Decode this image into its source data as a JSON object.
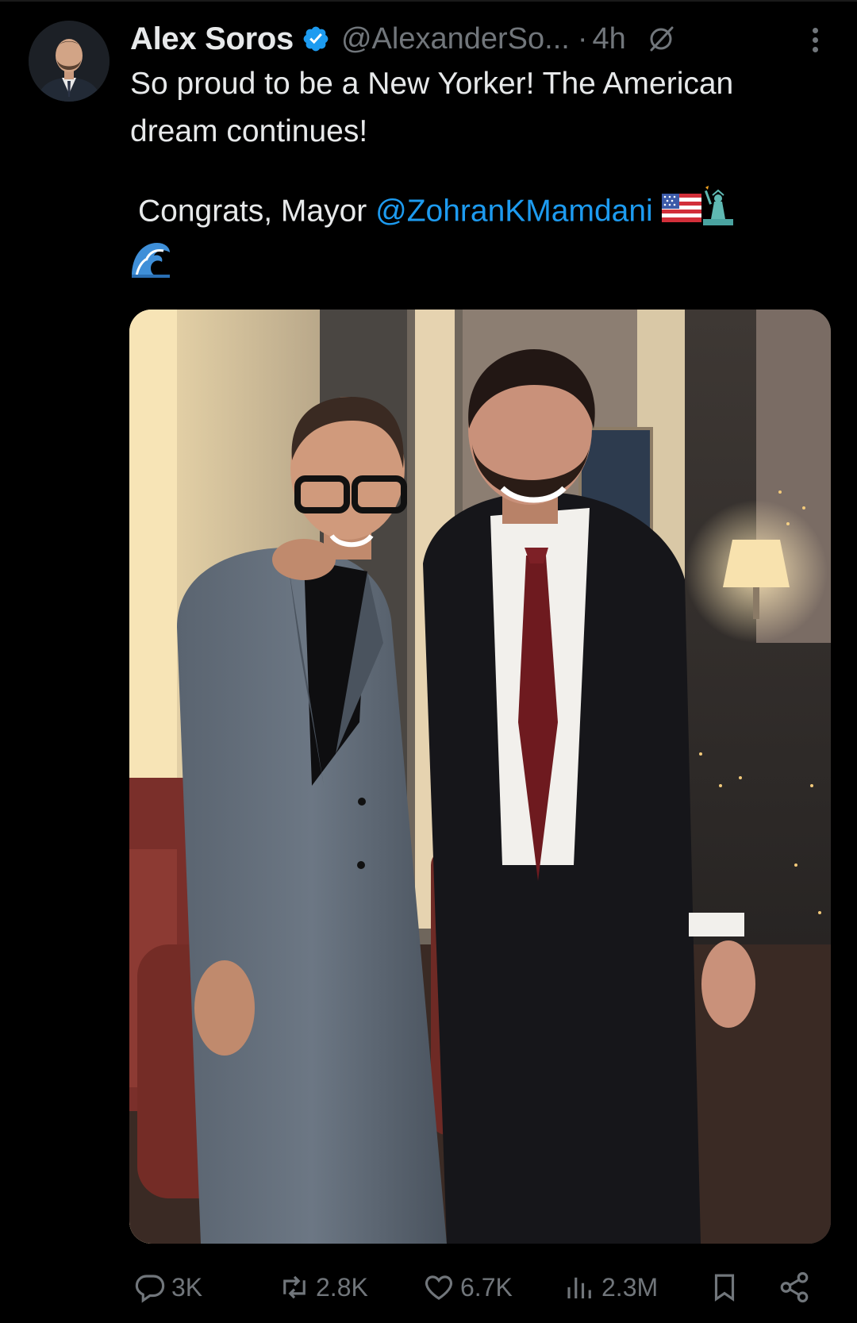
{
  "tweet": {
    "author_name": "Alex Soros",
    "handle": "@AlexanderSo...",
    "separator": "·",
    "time": "4h",
    "text_line1": "So proud to be a New Yorker! The American dream continues!",
    "text_line2_prefix": "Congrats, Mayor ",
    "mention": "@ZohranKMamdani",
    "emojis": [
      "us-flag",
      "statue-of-liberty",
      "water-wave"
    ]
  },
  "actions": {
    "replies": "3K",
    "reposts": "2.8K",
    "likes": "6.7K",
    "views": "2.3M"
  },
  "icons": {
    "verified": "verified-badge-icon",
    "grok": "grok-icon",
    "more": "more-icon",
    "reply": "reply-icon",
    "repost": "repost-icon",
    "like": "like-icon",
    "views": "views-icon",
    "bookmark": "bookmark-icon",
    "share": "share-icon"
  },
  "colors": {
    "background": "#000000",
    "text": "#e7e9ea",
    "muted": "#71767b",
    "accent": "#1d9bf0"
  }
}
